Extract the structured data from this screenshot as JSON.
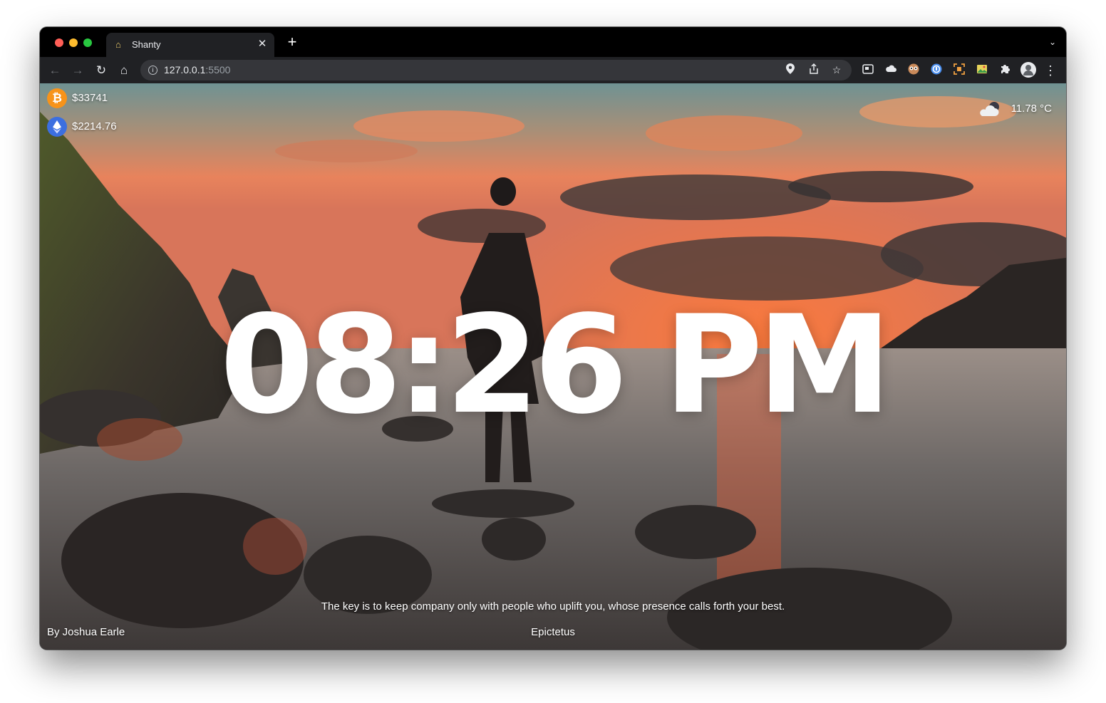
{
  "browser": {
    "tab_title": "Shanty",
    "tab_favicon": "house-icon",
    "new_tab_symbol": "+",
    "url_host": "127.0.0.1",
    "url_port": ":5500",
    "extensions": [
      "reader-icon",
      "cloud-icon",
      "eyes-icon",
      "password-icon",
      "capture-icon",
      "image-icon",
      "puzzle-icon",
      "profile-icon"
    ]
  },
  "crypto": {
    "bitcoin": {
      "icon": "bitcoin-icon",
      "price": "$33741"
    },
    "ethereum": {
      "icon": "ethereum-icon",
      "price": "$2214.76"
    }
  },
  "weather": {
    "icon": "cloudy-night-icon",
    "temperature": "11.78 °C"
  },
  "clock": {
    "time": "08:26 PM"
  },
  "quote": {
    "text": "The key is to keep company only with people who uplift you, whose presence calls forth your best.",
    "author": "Epictetus"
  },
  "photo_credit": "By Joshua Earle",
  "colors": {
    "tab_strip": "#000000",
    "toolbar": "#202124",
    "omnibox": "#35363a",
    "bitcoin": "#f7931a",
    "ethereum": "#3c6fe0"
  }
}
